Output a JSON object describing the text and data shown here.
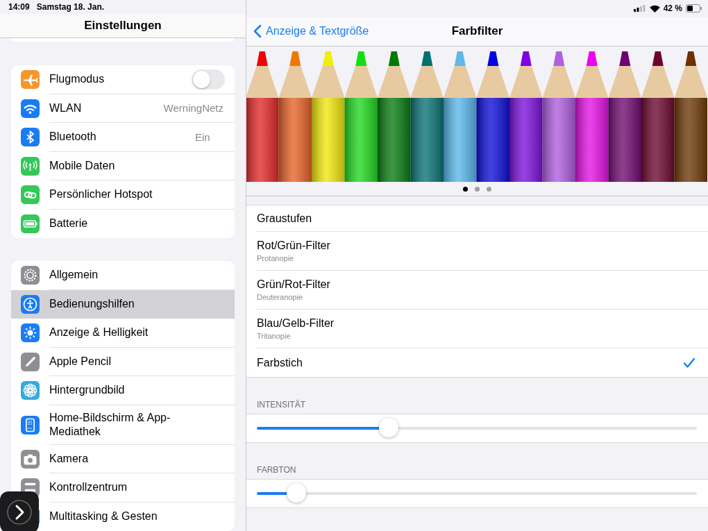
{
  "status_bar": {
    "time": "14:09",
    "date": "Samstag 18. Jan.",
    "battery": "42 %"
  },
  "sidebar": {
    "title": "Einstellungen",
    "groups": [
      [
        {
          "kind": "toggle",
          "label": "Flugmodus",
          "color": "#f7962b",
          "on": false,
          "selected": false
        },
        {
          "kind": "value",
          "label": "WLAN",
          "value": "WerningNetz",
          "color": "#1a7cf5",
          "selected": false
        },
        {
          "kind": "value",
          "label": "Bluetooth",
          "value": "Ein",
          "color": "#1a7cf5",
          "selected": false
        },
        {
          "kind": "plain",
          "label": "Mobile Daten",
          "color": "#34c759",
          "selected": false
        },
        {
          "kind": "plain",
          "label": "Persönlicher Hotspot",
          "color": "#34c759",
          "selected": false
        },
        {
          "kind": "plain",
          "label": "Batterie",
          "color": "#34c759",
          "selected": false
        }
      ],
      [
        {
          "kind": "plain",
          "label": "Allgemein",
          "color": "#8e8e93",
          "selected": false
        },
        {
          "kind": "plain",
          "label": "Bedienungshilfen",
          "color": "#1a7cf5",
          "selected": true
        },
        {
          "kind": "plain",
          "label": "Anzeige & Helligkeit",
          "color": "#1a7cf5",
          "selected": false
        },
        {
          "kind": "plain",
          "label": "Apple Pencil",
          "color": "#8e8e93",
          "selected": false
        },
        {
          "kind": "plain",
          "label": "Hintergrundbild",
          "color": "#35aadc",
          "selected": false
        },
        {
          "kind": "plain",
          "label": "Home-Bildschirm & App-Mediathek",
          "color": "#1a7cf5",
          "selected": false
        },
        {
          "kind": "plain",
          "label": "Kamera",
          "color": "#8e8e93",
          "selected": false
        },
        {
          "kind": "plain",
          "label": "Kontrollzentrum",
          "color": "#8e8e93",
          "selected": false
        },
        {
          "kind": "plain",
          "label": "Multitasking & Gesten",
          "color": "#1a7cf5",
          "selected": false
        }
      ]
    ]
  },
  "detail": {
    "back": "Anzeige & Textgröße",
    "title": "Farbfilter",
    "page_dots": [
      {
        "selected": true
      },
      {
        "selected": false
      },
      {
        "selected": false
      }
    ],
    "filters": [
      {
        "label": "Graustufen",
        "selected": false
      },
      {
        "label": "Rot/Grün-Filter",
        "subtitle": "Protanopie",
        "selected": false
      },
      {
        "label": "Grün/Rot-Filter",
        "subtitle": "Deuteranopie",
        "selected": false
      },
      {
        "label": "Blau/Gelb-Filter",
        "subtitle": "Tritanopie",
        "selected": false
      },
      {
        "label": "Farbstich",
        "selected": true
      }
    ],
    "sliders": [
      {
        "header": "INTENSITÄT",
        "level": 0.3
      },
      {
        "header": "FARBTON",
        "level": 0.09
      }
    ]
  }
}
